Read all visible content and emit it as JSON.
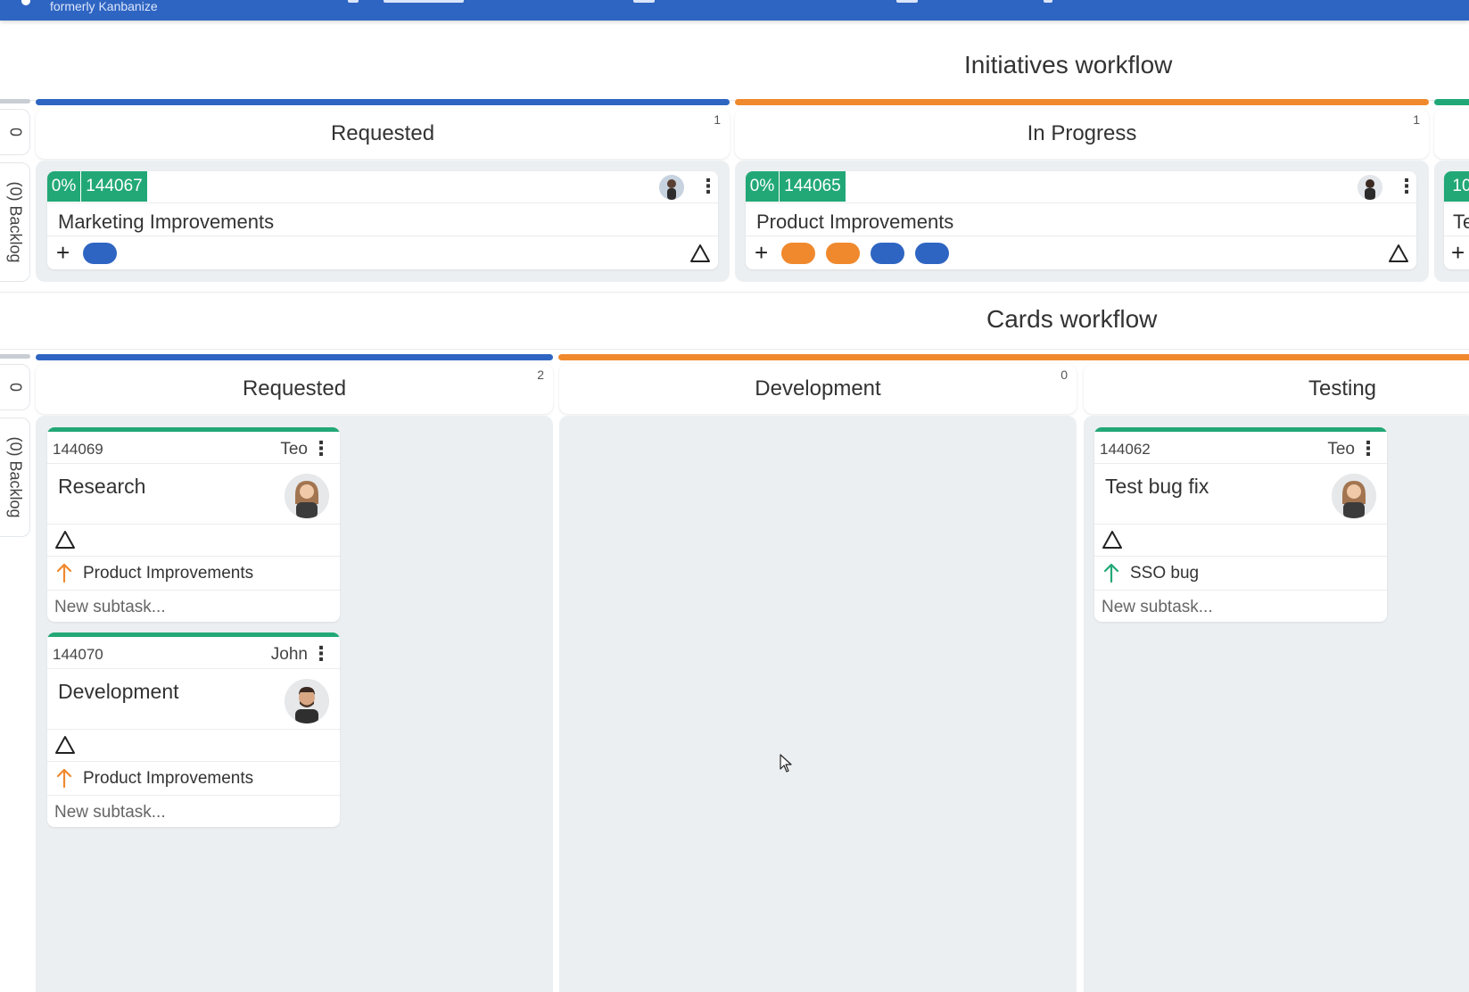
{
  "topbar": {
    "subtitle": "formerly Kanbanize"
  },
  "colors": {
    "blue": "#2f65c2",
    "orange": "#f0892d",
    "green": "#22a877",
    "gray": "#c9ced4"
  },
  "initiatives": {
    "title": "Initiatives workflow",
    "lane": {
      "count": "0",
      "label": "(0) Backlog"
    },
    "columns": [
      {
        "name": "Requested",
        "count": "1"
      },
      {
        "name": "In Progress",
        "count": "1"
      }
    ],
    "cards": [
      {
        "percent": "0%",
        "id": "144067",
        "title": "Marketing Improvements"
      },
      {
        "percent": "0%",
        "id": "144065",
        "title": "Product Improvements"
      },
      {
        "percent": "10",
        "title": "Te"
      }
    ]
  },
  "cards_workflow": {
    "title": "Cards workflow",
    "lane": {
      "count": "0",
      "label": "(0) Backlog"
    },
    "columns": [
      {
        "name": "Requested",
        "count": "2"
      },
      {
        "name": "Development",
        "count": "0"
      },
      {
        "name": "Testing"
      }
    ],
    "cards": [
      {
        "id": "144069",
        "owner": "Teo",
        "title": "Research",
        "parent": "Product Improvements",
        "subtask_placeholder": "New subtask..."
      },
      {
        "id": "144070",
        "owner": "John",
        "title": "Development",
        "parent": "Product Improvements",
        "subtask_placeholder": "New subtask..."
      },
      {
        "id": "144062",
        "owner": "Teo",
        "title": "Test bug fix",
        "parent": "SSO bug",
        "subtask_placeholder": "New subtask..."
      }
    ]
  }
}
